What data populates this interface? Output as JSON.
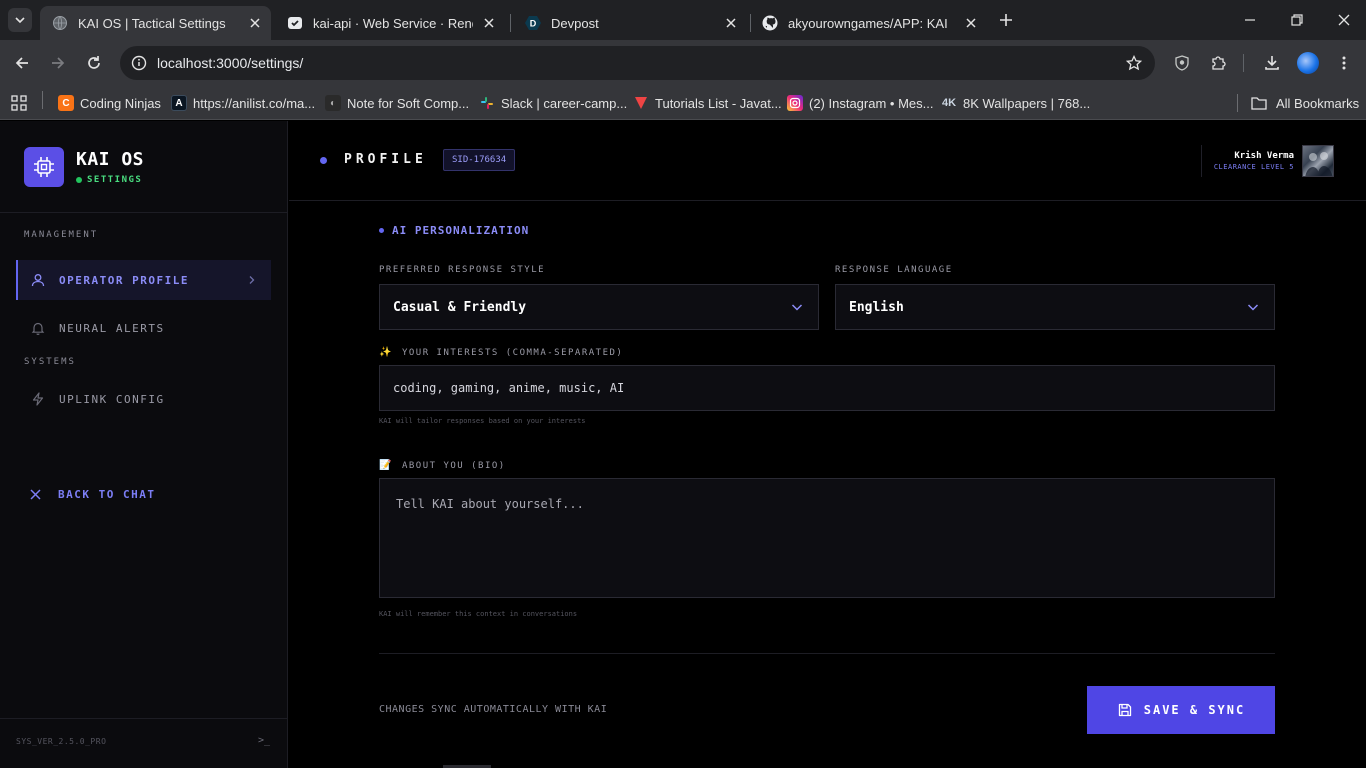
{
  "browser": {
    "tabs": [
      {
        "title": "KAI OS | Tactical Settings",
        "favicon": "globe-icon",
        "active": true
      },
      {
        "title": "kai-api · Web Service · Render",
        "favicon": "render-icon",
        "active": false
      },
      {
        "title": "Devpost",
        "favicon": "devpost-icon",
        "active": false
      },
      {
        "title": "akyourowngames/APP: KAI",
        "favicon": "github-icon",
        "active": false
      }
    ],
    "url": "localhost:3000/settings/",
    "bookmarks": [
      {
        "label": "Coding Ninjas",
        "icon": "coding-ninjas-icon",
        "color": "#f97316"
      },
      {
        "label": "https://anilist.co/ma...",
        "icon": "anilist-icon",
        "color": "#0b1622"
      },
      {
        "label": "Note for Soft Comp...",
        "icon": "notes-icon",
        "color": "#3a3a3a"
      },
      {
        "label": "Slack | career-camp...",
        "icon": "slack-icon",
        "color": "#4a154b"
      },
      {
        "label": "Tutorials List - Javat...",
        "icon": "javatpoint-icon",
        "color": "#ef4444"
      },
      {
        "label": "(2) Instagram • Mes...",
        "icon": "instagram-icon",
        "color": "#e1306c"
      },
      {
        "label": "8K Wallpapers | 768...",
        "icon": "wallpapers-icon",
        "color": "#475569"
      }
    ],
    "all_bookmarks": "All Bookmarks"
  },
  "sidebar": {
    "brand": "KAI OS",
    "brand_status": "SETTINGS",
    "sections": {
      "management": "MANAGEMENT",
      "systems": "SYSTEMS"
    },
    "items": [
      {
        "label": "OPERATOR PROFILE",
        "icon": "user-icon",
        "active": true
      },
      {
        "label": "NEURAL ALERTS",
        "icon": "bell-icon",
        "active": false
      },
      {
        "label": "UPLINK CONFIG",
        "icon": "lightning-icon",
        "active": false
      }
    ],
    "back_to_chat": "BACK TO CHAT",
    "version": "SYS_VER_2.5.0_PRO",
    "terminal": ">_"
  },
  "header": {
    "title": "PROFILE",
    "session_id": "SID-176634",
    "user_name": "Krish Verma",
    "clearance": "CLEARANCE LEVEL 5"
  },
  "personalization": {
    "section_title": "AI PERSONALIZATION",
    "response_style": {
      "label": "PREFERRED RESPONSE STYLE",
      "value": "Casual & Friendly"
    },
    "response_language": {
      "label": "RESPONSE LANGUAGE",
      "value": "English"
    },
    "interests": {
      "emoji": "✨",
      "label": "YOUR INTERESTS (COMMA-SEPARATED)",
      "value": "coding, gaming, anime, music, AI",
      "hint": "KAI will tailor responses based on your interests"
    },
    "bio": {
      "emoji": "📝",
      "label": "ABOUT YOU (BIO)",
      "placeholder": "Tell KAI about yourself...",
      "hint": "KAI will remember this context in conversations"
    }
  },
  "footer": {
    "sync_note": "CHANGES SYNC AUTOMATICALLY WITH KAI",
    "save_button": "SAVE & SYNC"
  },
  "colors": {
    "accent": "#6366f1",
    "button": "#4f46e5",
    "status": "#22c55e",
    "background": "#000000"
  }
}
